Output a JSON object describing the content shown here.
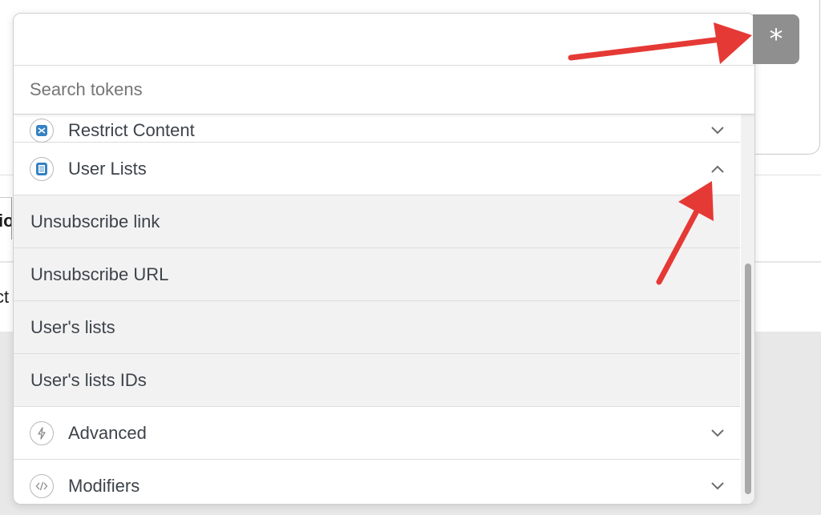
{
  "search": {
    "placeholder": "Search tokens",
    "value": ""
  },
  "token_button": {
    "label": "*"
  },
  "groups": [
    {
      "label": "Restrict Content",
      "icon": "restrict-content-icon",
      "expanded": false
    },
    {
      "label": "User Lists",
      "icon": "clipboard-icon",
      "expanded": true
    }
  ],
  "user_lists_items": [
    {
      "label": "Unsubscribe link"
    },
    {
      "label": "Unsubscribe URL"
    },
    {
      "label": "User's lists"
    },
    {
      "label": "User's lists IDs"
    }
  ],
  "more_groups": [
    {
      "label": "Advanced",
      "icon": "lightning-icon",
      "expanded": false
    },
    {
      "label": "Modifiers",
      "icon": "code-icon",
      "expanded": false
    }
  ],
  "background": {
    "tab_fragment": "io",
    "text_fragment": "ct"
  },
  "colors": {
    "arrow": "#e53935",
    "accent": "#3582c4",
    "button": "#8f8f8f"
  }
}
